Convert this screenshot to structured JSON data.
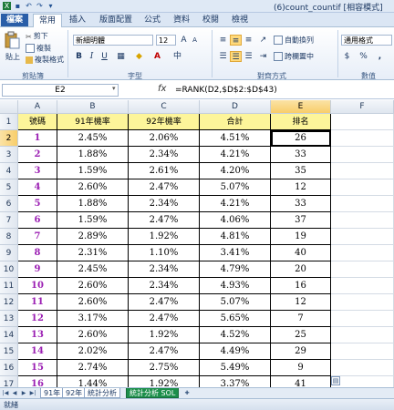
{
  "window": {
    "title": "(6)count_countif [相容模式]"
  },
  "ribbon": {
    "tabs": [
      "檔案",
      "常用",
      "插入",
      "版面配置",
      "公式",
      "資料",
      "校閱",
      "檢視"
    ],
    "clipboard": {
      "paste": "貼上",
      "cut": "剪下",
      "copy": "複製",
      "format_painter": "複製格式",
      "group": "剪貼簿"
    },
    "font": {
      "name": "新細明體",
      "size": "12",
      "group": "字型"
    },
    "alignment": {
      "wrap": "自動換列",
      "merge": "跨欄置中",
      "group": "對齊方式"
    },
    "number": {
      "format": "通用格式",
      "group": "數值"
    }
  },
  "formula_bar": {
    "name_box": "E2",
    "fx": "fx",
    "formula": "=RANK(D2,$D$2:$D$43)"
  },
  "sheet": {
    "columns": [
      "A",
      "B",
      "C",
      "D",
      "E",
      "F"
    ],
    "row_numbers": [
      "1",
      "2",
      "3",
      "4",
      "5",
      "6",
      "7",
      "8",
      "9",
      "10",
      "11",
      "12",
      "13",
      "14",
      "15",
      "16",
      "17",
      "18",
      "19"
    ],
    "headers": [
      "號碼",
      "91年機率",
      "92年機率",
      "合計",
      "排名"
    ],
    "rows": [
      [
        "1",
        "2.45%",
        "2.06%",
        "4.51%",
        "26"
      ],
      [
        "2",
        "1.88%",
        "2.34%",
        "4.21%",
        "33"
      ],
      [
        "3",
        "1.59%",
        "2.61%",
        "4.20%",
        "35"
      ],
      [
        "4",
        "2.60%",
        "2.47%",
        "5.07%",
        "12"
      ],
      [
        "5",
        "1.88%",
        "2.34%",
        "4.21%",
        "33"
      ],
      [
        "6",
        "1.59%",
        "2.47%",
        "4.06%",
        "37"
      ],
      [
        "7",
        "2.89%",
        "1.92%",
        "4.81%",
        "19"
      ],
      [
        "8",
        "2.31%",
        "1.10%",
        "3.41%",
        "40"
      ],
      [
        "9",
        "2.45%",
        "2.34%",
        "4.79%",
        "20"
      ],
      [
        "10",
        "2.60%",
        "2.34%",
        "4.93%",
        "16"
      ],
      [
        "11",
        "2.60%",
        "2.47%",
        "5.07%",
        "12"
      ],
      [
        "12",
        "3.17%",
        "2.47%",
        "5.65%",
        "7"
      ],
      [
        "13",
        "2.60%",
        "1.92%",
        "4.52%",
        "25"
      ],
      [
        "14",
        "2.02%",
        "2.47%",
        "4.49%",
        "29"
      ],
      [
        "15",
        "2.74%",
        "2.75%",
        "5.49%",
        "9"
      ],
      [
        "16",
        "1.44%",
        "1.92%",
        "3.37%",
        "41"
      ],
      [
        "17",
        "2.45%",
        "2.06%",
        "4.51%",
        "26"
      ],
      [
        "18",
        "2.16%",
        "1.65%",
        "3.81%",
        "38"
      ]
    ]
  },
  "sheet_tabs": [
    "91年",
    "92年",
    "統計分析",
    "統計分析 SOL"
  ],
  "status": {
    "text": "就緒"
  }
}
